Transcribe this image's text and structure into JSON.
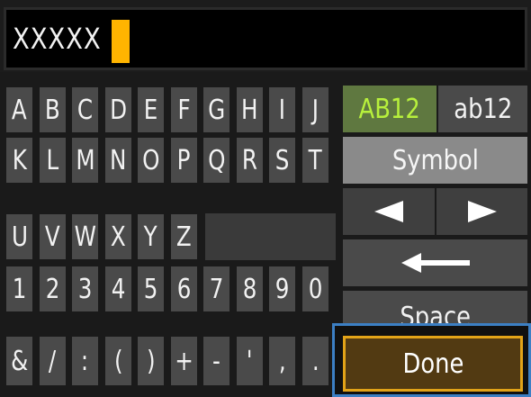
{
  "input": {
    "value": "XXXXX"
  },
  "keyboard": {
    "rows": [
      [
        "A",
        "B",
        "C",
        "D",
        "E",
        "F",
        "G",
        "H",
        "I",
        "J"
      ],
      [
        "K",
        "L",
        "M",
        "N",
        "O",
        "P",
        "Q",
        "R",
        "S",
        "T"
      ],
      [
        "U",
        "V",
        "W",
        "X",
        "Y",
        "Z"
      ],
      [
        "1",
        "2",
        "3",
        "4",
        "5",
        "6",
        "7",
        "8",
        "9",
        "0"
      ],
      [
        "&",
        "/",
        ":",
        "(",
        ")",
        "+",
        "-",
        "'",
        ",",
        "."
      ]
    ]
  },
  "side_panel": {
    "mode_upper": "AB12",
    "mode_lower": "ab12",
    "symbol": "Symbol",
    "left_arrow_icon": "left-arrow-icon",
    "right_arrow_icon": "right-arrow-icon",
    "backspace_icon": "backspace-arrow-icon",
    "space": "Space",
    "done": "Done"
  },
  "colors": {
    "cursor": "#ffb400",
    "mode_active_text": "#b7f03c",
    "done_border": "#e2a318",
    "focus_frame": "#3c7fc4"
  }
}
